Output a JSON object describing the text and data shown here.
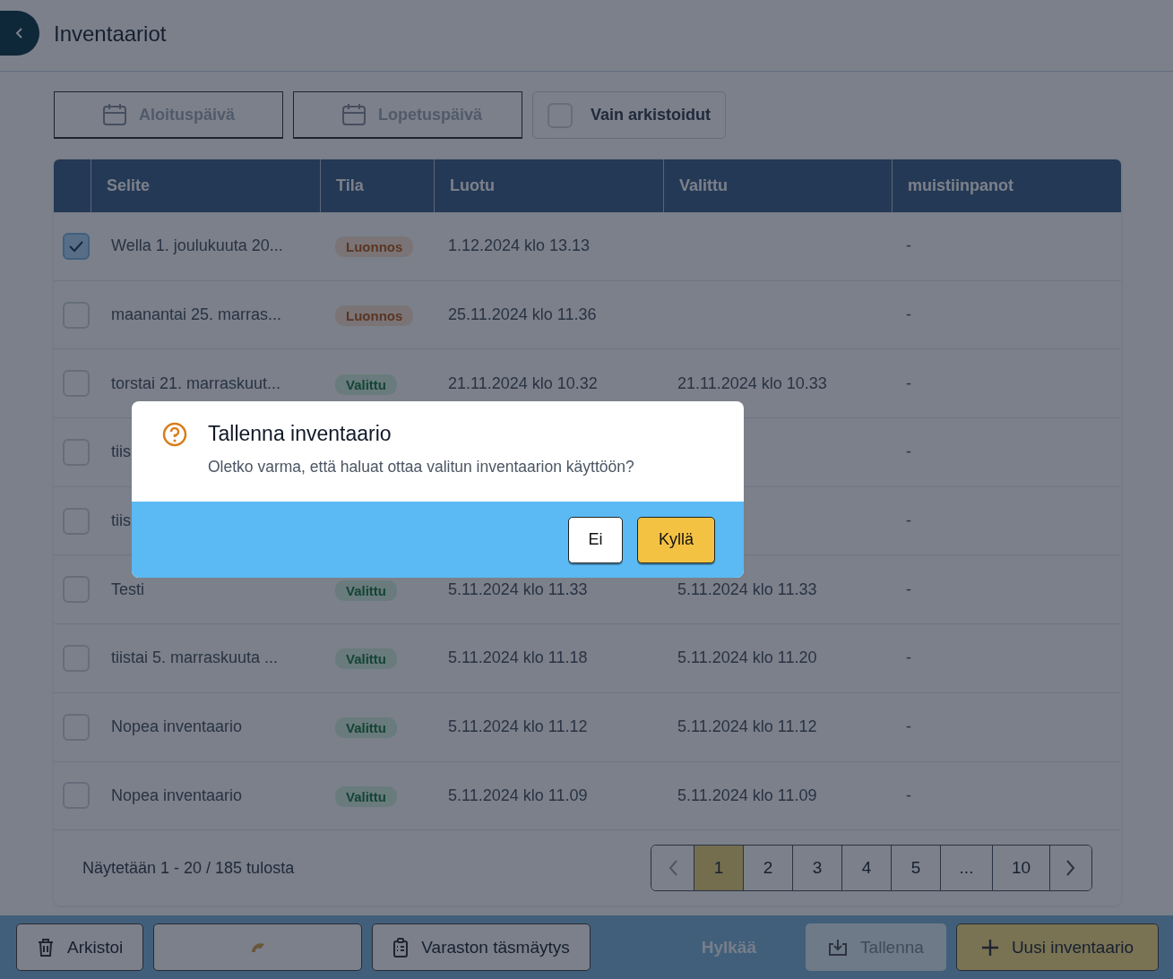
{
  "header": {
    "title": "Inventaariot"
  },
  "filters": {
    "start_date": {
      "placeholder": "Aloituspäivä"
    },
    "end_date": {
      "placeholder": "Lopetuspäivä"
    },
    "archived_only": {
      "label": "Vain arkistoidut",
      "checked": false
    }
  },
  "table": {
    "columns": [
      "Selite",
      "Tila",
      "Luotu",
      "Valittu",
      "muistiinpanot"
    ],
    "rows": [
      {
        "checked": true,
        "selite": "Wella 1. joulukuuta 20...",
        "status": {
          "label": "Luonnos",
          "kind": "draft"
        },
        "created": "1.12.2024 klo 13.13",
        "notes": "-"
      },
      {
        "checked": false,
        "selite": "maanantai 25. marras...",
        "status": {
          "label": "Luonnos",
          "kind": "draft"
        },
        "created": "25.11.2024 klo 11.36",
        "notes": "-"
      },
      {
        "checked": false,
        "selite": "torstai 21. marraskuut...",
        "status": {
          "label": "Valittu",
          "kind": "chosen"
        },
        "created": "21.11.2024 klo 10.32",
        "chosen": "21.11.2024 klo 10.33",
        "notes": "-"
      },
      {
        "checked": false,
        "selite": "tiis",
        "notes": "-"
      },
      {
        "checked": false,
        "selite": "tiis",
        "notes": "-"
      },
      {
        "checked": false,
        "selite": "Testi",
        "status": {
          "label": "Valittu",
          "kind": "chosen"
        },
        "created": "5.11.2024 klo 11.33",
        "chosen": "5.11.2024 klo 11.33",
        "notes": "-"
      },
      {
        "checked": false,
        "selite": "tiistai 5. marraskuuta ...",
        "status": {
          "label": "Valittu",
          "kind": "chosen"
        },
        "created": "5.11.2024 klo 11.18",
        "chosen": "5.11.2024 klo 11.20",
        "notes": "-"
      },
      {
        "checked": false,
        "selite": "Nopea inventaario",
        "status": {
          "label": "Valittu",
          "kind": "chosen"
        },
        "created": "5.11.2024 klo 11.12",
        "chosen": "5.11.2024 klo 11.12",
        "notes": "-"
      },
      {
        "checked": false,
        "selite": "Nopea inventaario",
        "status": {
          "label": "Valittu",
          "kind": "chosen"
        },
        "created": "5.11.2024 klo 11.09",
        "chosen": "5.11.2024 klo 11.09",
        "notes": "-"
      }
    ]
  },
  "pagination": {
    "summary": "Näytetään 1 - 20 / 185 tulosta",
    "pages": [
      {
        "label": "1",
        "selected": true
      },
      {
        "label": "2",
        "selected": false
      },
      {
        "label": "3",
        "selected": false
      },
      {
        "label": "4",
        "selected": false
      },
      {
        "label": "5",
        "selected": false
      },
      {
        "label": "...",
        "selected": false
      },
      {
        "label": "10",
        "selected": false
      }
    ]
  },
  "actions": [
    {
      "kind": "archive",
      "label": "Arkistoi",
      "disabled": false
    },
    {
      "kind": "loading",
      "disabled": false
    },
    {
      "kind": "reconcile",
      "label": "Varaston täsmäytys",
      "disabled": false
    },
    {
      "kind": "discard",
      "label": "Hylkää",
      "disabled": true
    },
    {
      "kind": "save",
      "label": "Tallenna",
      "disabled": true
    },
    {
      "kind": "new",
      "label": "Uusi inventaario",
      "disabled": false
    }
  ],
  "dialog": {
    "title": "Tallenna inventaario",
    "message": "Oletko varma, että haluat ottaa valitun inventaarion käyttöön?",
    "buttons": [
      {
        "kind": "secondary",
        "label": "Ei"
      },
      {
        "kind": "primary",
        "label": "Kyllä"
      }
    ]
  }
}
